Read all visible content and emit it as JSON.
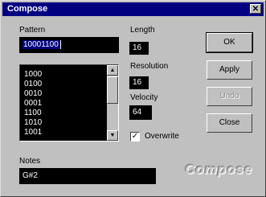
{
  "window": {
    "title": "Compose",
    "close_symbol": "✕"
  },
  "pattern": {
    "label": "Pattern",
    "value": "10001100"
  },
  "list": {
    "items": [
      "1000",
      "0100",
      "0010",
      "0001",
      "1100",
      "1010",
      "1001"
    ]
  },
  "scroll": {
    "up_symbol": "▲",
    "down_symbol": "▼"
  },
  "length": {
    "label": "Length",
    "value": "16"
  },
  "resolution": {
    "label": "Resolution",
    "value": "16"
  },
  "velocity": {
    "label": "Velocity",
    "value": "64"
  },
  "overwrite": {
    "label": "Overwrite",
    "checked": true,
    "check_symbol": "✓"
  },
  "notes": {
    "label": "Notes",
    "value": "G#2"
  },
  "buttons": {
    "ok": "OK",
    "apply": "Apply",
    "undo": "Undo",
    "close": "Close"
  },
  "logo": {
    "text": "Compose"
  }
}
